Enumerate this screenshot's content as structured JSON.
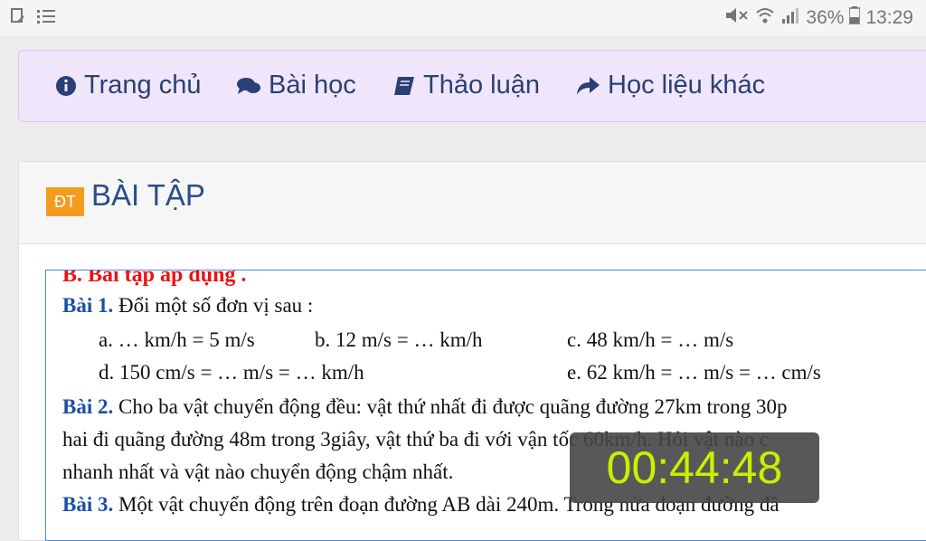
{
  "status": {
    "battery_percent": "36%",
    "time": "13:29",
    "left_icons": [
      "notification-icon",
      "list-icon"
    ],
    "right_icons": [
      "mute-icon",
      "wifi-icon",
      "signal-icon",
      "battery-icon"
    ]
  },
  "nav": {
    "items": [
      {
        "icon": "info-icon",
        "label": "Trang chủ"
      },
      {
        "icon": "comments-icon",
        "label": "Bài học"
      },
      {
        "icon": "book-icon",
        "label": "Thảo luận"
      },
      {
        "icon": "share-icon",
        "label": "Học liệu khác"
      }
    ]
  },
  "card": {
    "badge": "ĐT",
    "title": "BÀI TẬP"
  },
  "doc": {
    "heading": "B. Bài tập áp dụng .",
    "bai1_label": "Bài 1.",
    "bai1_text": " Đổi một số đơn vị sau  :",
    "bai1_a": "a. … km/h = 5 m/s",
    "bai1_b": "b. 12 m/s = … km/h",
    "bai1_c": "c. 48 km/h = … m/s",
    "bai1_d": "d. 150 cm/s  = … m/s  = … km/h",
    "bai1_e": "e. 62 km/h = … m/s = … cm/s",
    "bai2_label": "Bài 2.",
    "bai2_text1": " Cho ba vật chuyển động đều: vật thứ nhất đi được quãng đường 27km trong 30p",
    "bai2_text2": "hai đi quãng đường 48m trong 3giây, vật thứ ba đi với vận tốc 60km/h. Hỏi vật nào c",
    "bai2_text3": "nhanh nhất và vật nào chuyển động chậm nhất.",
    "bai3_label": "Bài 3.",
    "bai3_text": " Một vật chuyển động trên đoạn đường AB dài 240m. Trong nửa đoạn đường đầ"
  },
  "timer": "00:44:48",
  "colors": {
    "nav_bg": "#efe6fb",
    "nav_text": "#2a3f74",
    "badge": "#f39c1f",
    "title": "#2a4d8c",
    "timer_text": "#c8f000"
  }
}
